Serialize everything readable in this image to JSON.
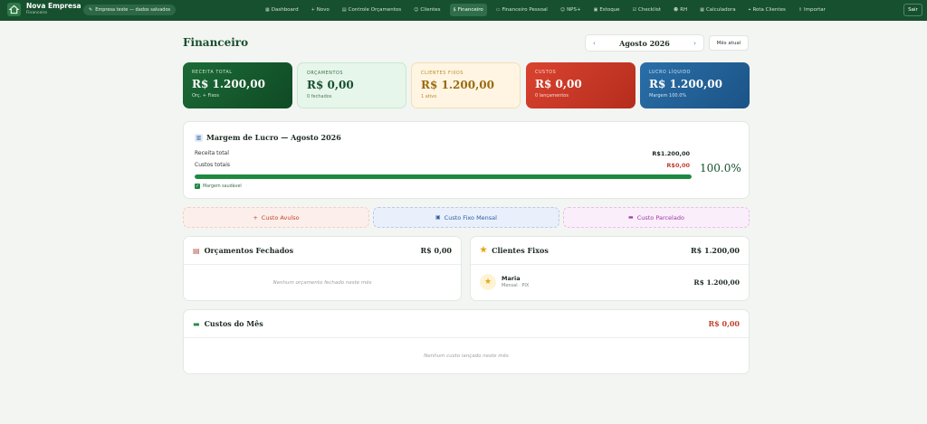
{
  "app": {
    "name": "Nova Empresa",
    "section": "Financeiro",
    "company_pill": "Empresa teste — dados salvados"
  },
  "nav": [
    {
      "label": "Dashboard",
      "icon": "▦"
    },
    {
      "label": "Novo",
      "icon": "+"
    },
    {
      "label": "Controle Orçamentos",
      "icon": "▤"
    },
    {
      "label": "Clientes",
      "icon": "☺"
    },
    {
      "label": "Financeiro",
      "icon": "$"
    },
    {
      "label": "Financeiro Pessoal",
      "icon": "▭"
    },
    {
      "label": "NPS+",
      "icon": "☺"
    },
    {
      "label": "Estoque",
      "icon": "▣"
    },
    {
      "label": "Checklist",
      "icon": "☑"
    },
    {
      "label": "RH",
      "icon": "☻"
    },
    {
      "label": "Calculadora",
      "icon": "▦"
    },
    {
      "label": "Rota Clientes",
      "icon": "⌖"
    },
    {
      "label": "Importar",
      "icon": "⇪"
    }
  ],
  "logout_label": "Sair",
  "header": {
    "title": "Financeiro",
    "month": "Agosto 2026",
    "prev": "‹",
    "next": "›",
    "current_month_btn": "Mês atual"
  },
  "stats": [
    {
      "label": "RECEITA TOTAL",
      "value": "R$ 1.200,00",
      "sub": "Orç. + Fixos"
    },
    {
      "label": "ORÇAMENTOS",
      "value": "R$ 0,00",
      "sub": "0 fechados"
    },
    {
      "label": "CLIENTES FIXOS",
      "value": "R$ 1.200,00",
      "sub": "1 ativo"
    },
    {
      "label": "CUSTOS",
      "value": "R$ 0,00",
      "sub": "0 lançamentos"
    },
    {
      "label": "LUCRO LÍQUIDO",
      "value": "R$ 1.200,00",
      "sub": "Margem 100.0%"
    }
  ],
  "margin": {
    "title": "Margem de Lucro — Agosto 2026",
    "revenue_label": "Receita total",
    "revenue_value": "R$1.200,00",
    "cost_label": "Custos totais",
    "cost_value": "R$0,00",
    "progress_fraction": 1.0,
    "percent": "100.0%",
    "healthy_label": "Margem saudável",
    "colors": {
      "bar": "#1e8a3f",
      "cost": "#c4412d"
    }
  },
  "actions": {
    "avulso": "Custo Avulso",
    "fixo": "Custo Fixo Mensal",
    "parcelado": "Custo Parcelado"
  },
  "orcamentos": {
    "title": "Orçamentos Fechados",
    "total": "R$ 0,00",
    "empty": "Nenhum orçamento fechado neste mês"
  },
  "clientes_fixos": {
    "title": "Clientes Fixos",
    "total": "R$ 1.200,00",
    "items": [
      {
        "name": "Maria",
        "sub": "Mensal · PIX",
        "value": "R$ 1.200,00"
      }
    ]
  },
  "custos": {
    "title": "Custos do Mês",
    "total": "R$ 0,00",
    "empty": "Nenhum custo lançado neste mês"
  }
}
